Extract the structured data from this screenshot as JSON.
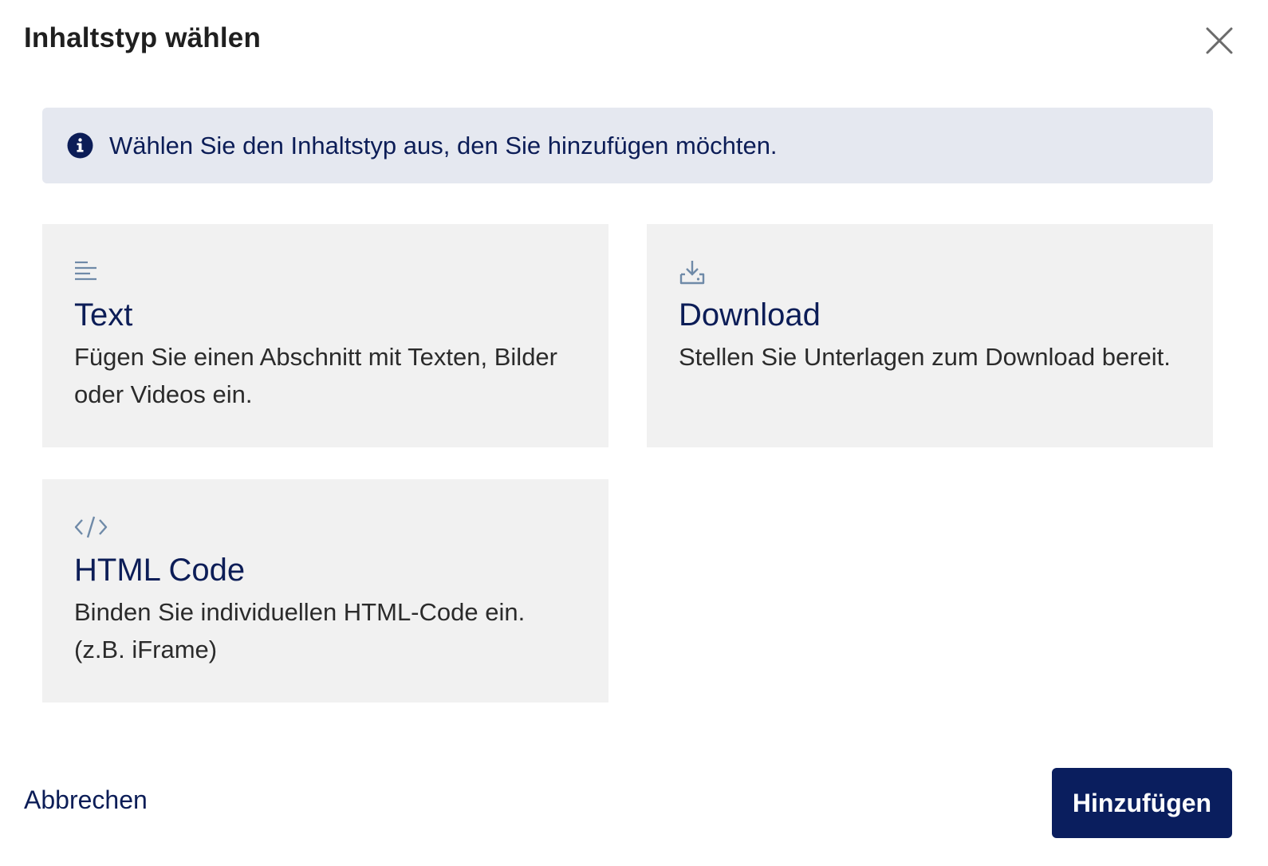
{
  "dialog": {
    "title": "Inhaltstyp wählen",
    "close_icon": "close-icon"
  },
  "info": {
    "icon": "info-icon",
    "text": "Wählen Sie den Inhaltstyp aus, den Sie hinzufügen möchten."
  },
  "options": [
    {
      "icon": "text-lines-icon",
      "title": "Text",
      "description": "Fügen Sie einen Abschnitt mit Texten, Bilder oder Videos ein."
    },
    {
      "icon": "download-icon",
      "title": "Download",
      "description": "Stellen Sie Unterlagen zum Download bereit."
    },
    {
      "icon": "code-icon",
      "title": "HTML Code",
      "description": "Binden Sie individuellen HTML-Code ein. (z.B. iFrame)"
    }
  ],
  "footer": {
    "cancel_label": "Abbrechen",
    "add_label": "Hinzufügen"
  },
  "colors": {
    "primary": "#0a1e5e",
    "text_dark": "#1f1f1f",
    "banner_bg": "#e5e8f0",
    "card_bg": "#f1f1f1",
    "icon_color": "#6f8aa8"
  }
}
